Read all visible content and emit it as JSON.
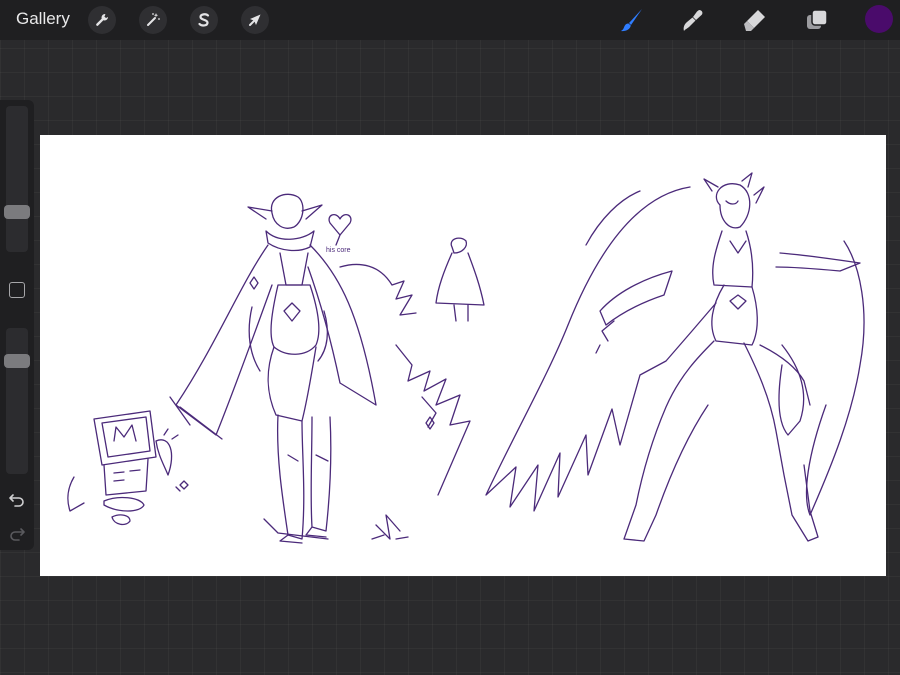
{
  "topbar": {
    "gallery_label": "Gallery",
    "left_tools": [
      {
        "name": "actions",
        "icon": "wrench-icon"
      },
      {
        "name": "adjustments",
        "icon": "magic-wand-icon"
      },
      {
        "name": "selection",
        "icon": "selection-s-icon"
      },
      {
        "name": "transform",
        "icon": "arrow-cursor-icon"
      }
    ],
    "right_tools": [
      {
        "name": "brush",
        "icon": "brush-icon",
        "active": true
      },
      {
        "name": "smudge",
        "icon": "smudge-icon"
      },
      {
        "name": "eraser",
        "icon": "eraser-icon"
      },
      {
        "name": "layers",
        "icon": "layers-icon"
      }
    ],
    "active_color": "#4a0b6b",
    "active_tool_color": "#2f7dff"
  },
  "sidebar": {
    "brush_size_level": 0.25,
    "opacity_level": 0.8,
    "icons": [
      "modify-square-icon",
      "undo-icon",
      "redo-icon"
    ]
  },
  "canvas": {
    "background": "#ffffff",
    "stroke_color": "#4b2a7a",
    "sketch_text": "his core"
  }
}
